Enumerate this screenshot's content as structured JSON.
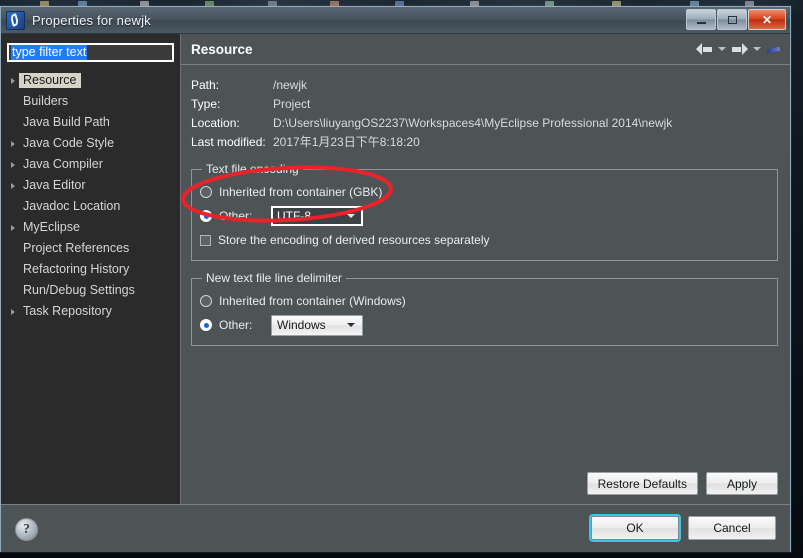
{
  "window": {
    "title": "Properties for newjk",
    "app_icon": "eclipse-icon",
    "controls": {
      "minimize": "minimize-icon",
      "maximize": "maximize-icon",
      "close": "✕"
    }
  },
  "sidebar": {
    "filter": {
      "value": "type filter text",
      "placeholder": "type filter text"
    },
    "items": [
      {
        "label": "Resource",
        "expandable": true,
        "selected": true
      },
      {
        "label": "Builders",
        "expandable": false,
        "selected": false
      },
      {
        "label": "Java Build Path",
        "expandable": false,
        "selected": false
      },
      {
        "label": "Java Code Style",
        "expandable": true,
        "selected": false
      },
      {
        "label": "Java Compiler",
        "expandable": true,
        "selected": false
      },
      {
        "label": "Java Editor",
        "expandable": true,
        "selected": false
      },
      {
        "label": "Javadoc Location",
        "expandable": false,
        "selected": false
      },
      {
        "label": "MyEclipse",
        "expandable": true,
        "selected": false
      },
      {
        "label": "Project References",
        "expandable": false,
        "selected": false
      },
      {
        "label": "Refactoring History",
        "expandable": false,
        "selected": false
      },
      {
        "label": "Run/Debug Settings",
        "expandable": false,
        "selected": false
      },
      {
        "label": "Task Repository",
        "expandable": true,
        "selected": false
      }
    ]
  },
  "main": {
    "page_title": "Resource",
    "nav": {
      "back": "back-arrow-icon",
      "forward": "forward-arrow-icon",
      "menu": "view-menu-icon"
    },
    "info": [
      {
        "label": "Path:",
        "value": "/newjk"
      },
      {
        "label": "Type:",
        "value": "Project"
      },
      {
        "label": "Location:",
        "value": "D:\\Users\\liuyangOS2237\\Workspaces4\\MyEclipse Professional 2014\\newjk"
      },
      {
        "label": "Last modified:",
        "value": "2017年1月23日下午8:18:20"
      }
    ],
    "encoding_group": {
      "legend": "Text file encoding",
      "inherited_label": "Inherited from container (GBK)",
      "inherited_selected": false,
      "other_label": "Other:",
      "other_selected": true,
      "other_value": "UTF-8",
      "store_label": "Store the encoding of derived resources separately",
      "store_checked": false
    },
    "delimiter_group": {
      "legend": "New text file line delimiter",
      "inherited_label": "Inherited from container (Windows)",
      "inherited_selected": false,
      "other_label": "Other:",
      "other_selected": true,
      "other_value": "Windows"
    },
    "buttons": {
      "restore_defaults": "Restore Defaults",
      "apply": "Apply"
    }
  },
  "footer": {
    "help": "?",
    "ok": "OK",
    "cancel": "Cancel"
  },
  "annotation": {
    "shape": "red-ellipse-highlight",
    "color": "#e8232a"
  }
}
